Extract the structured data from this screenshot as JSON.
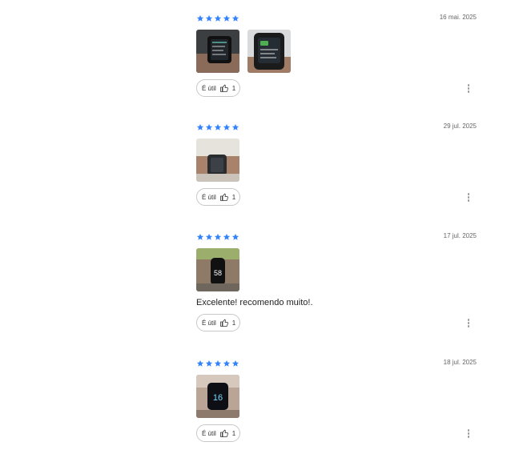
{
  "accent": "#3483fa",
  "reviews": [
    {
      "rating": 5,
      "date": "16 mai. 2025",
      "photos": [
        "watch-on-wrist-photo",
        "smartwatch-screen-photo"
      ],
      "text": "",
      "helpful_label": "É útil",
      "helpful_count": "1"
    },
    {
      "rating": 5,
      "date": "29 jul. 2025",
      "photos": [
        "watch-on-wrist-photo"
      ],
      "text": "",
      "helpful_label": "É útil",
      "helpful_count": "1"
    },
    {
      "rating": 5,
      "date": "17 jul. 2025",
      "photos": [
        "band-on-wrist-photo"
      ],
      "text": "Excelente! recomendo muito!.",
      "helpful_label": "É útil",
      "helpful_count": "1"
    },
    {
      "rating": 5,
      "date": "18 jul. 2025",
      "photos": [
        "watch-time-display-photo"
      ],
      "text": "",
      "helpful_label": "É útil",
      "helpful_count": "1"
    }
  ]
}
